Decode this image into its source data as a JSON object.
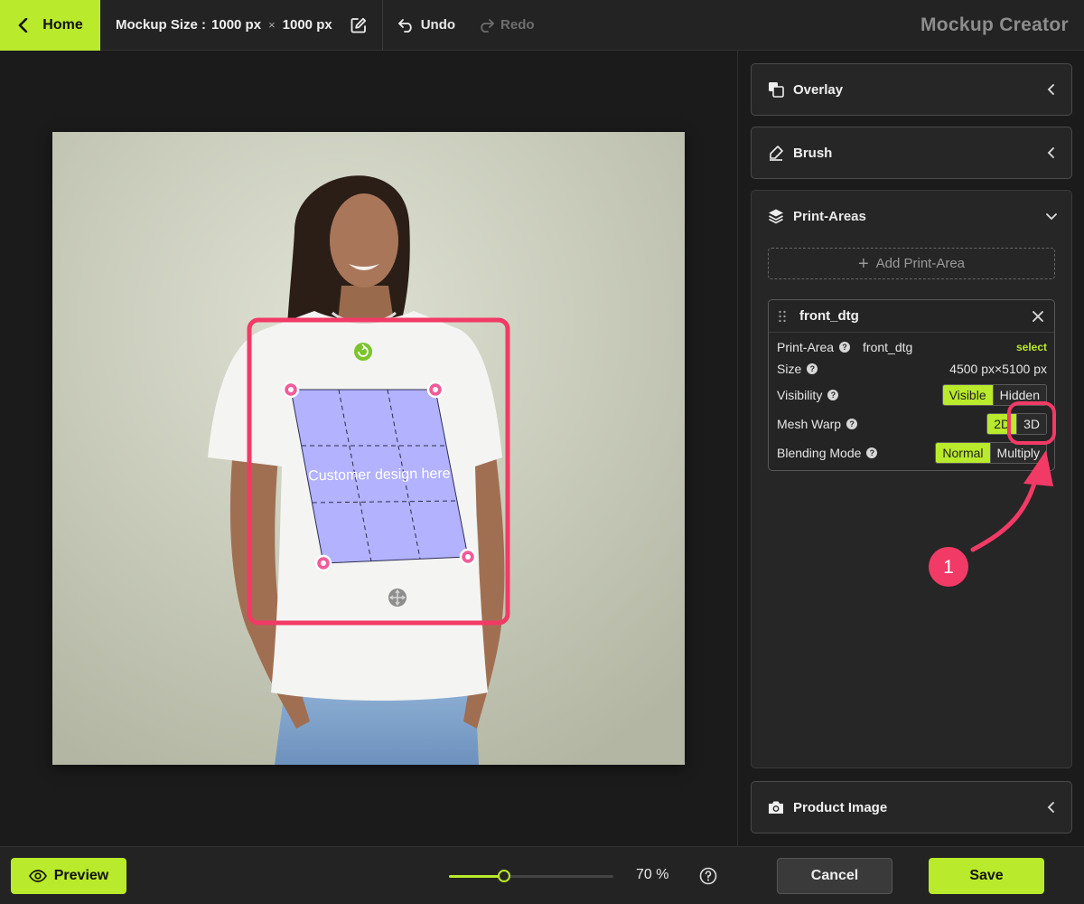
{
  "topbar": {
    "home_label": "Home",
    "mockup_size_label": "Mockup Size :",
    "width_value": "1000 px",
    "times_sign": "×",
    "height_value": "1000 px",
    "undo_label": "Undo",
    "redo_label": "Redo",
    "app_title": "Mockup Creator"
  },
  "canvas": {
    "design_placeholder": "Customer design here"
  },
  "panels": {
    "overlay": {
      "label": "Overlay",
      "icon": "overlay-icon"
    },
    "brush": {
      "label": "Brush",
      "icon": "brush-icon"
    },
    "print_areas": {
      "label": "Print-Areas",
      "icon": "layers-icon",
      "add_label": "Add Print-Area",
      "card": {
        "title": "front_dtg",
        "print_area_label": "Print-Area",
        "print_area_value": "front_dtg",
        "select_label": "select",
        "size_label": "Size",
        "size_value": "4500 px×5100 px",
        "visibility_label": "Visibility",
        "visibility_options": [
          "Visible",
          "Hidden"
        ],
        "visibility_selected": "Visible",
        "mesh_warp_label": "Mesh Warp",
        "mesh_warp_options": [
          "2D",
          "3D"
        ],
        "mesh_warp_selected": "2D",
        "blending_label": "Blending Mode",
        "blending_options": [
          "Normal",
          "Multiply"
        ],
        "blending_selected": "Normal"
      }
    },
    "product_image": {
      "label": "Product Image",
      "icon": "camera-icon"
    }
  },
  "annotation": {
    "step_number": "1"
  },
  "bottombar": {
    "preview_label": "Preview",
    "zoom_percent": 70,
    "zoom_label": "70 %",
    "cancel_label": "Cancel",
    "save_label": "Save"
  },
  "colors": {
    "accent": "#b9ea2b",
    "highlight": "#f23a66",
    "handle": "#f25b9a",
    "print_area_fill": "#b2b2ff"
  }
}
